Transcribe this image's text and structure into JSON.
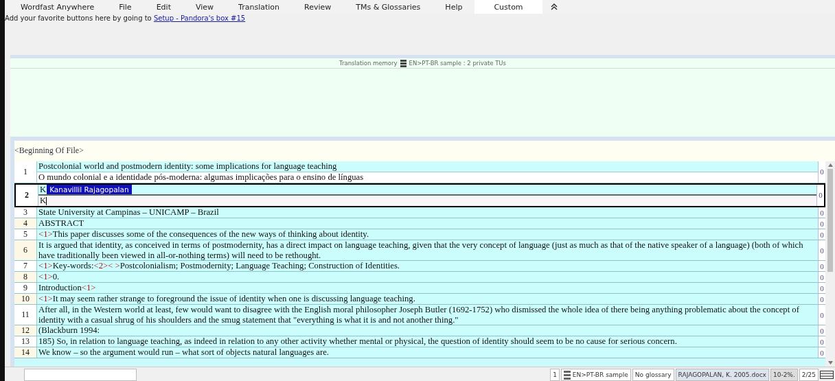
{
  "menu": [
    {
      "label": "Wordfast Anywhere",
      "selected": false
    },
    {
      "label": "File",
      "selected": false
    },
    {
      "label": "Edit",
      "selected": false
    },
    {
      "label": "View",
      "selected": false
    },
    {
      "label": "Translation",
      "selected": false
    },
    {
      "label": "Review",
      "selected": false
    },
    {
      "label": "TMs & Glossaries",
      "selected": false
    },
    {
      "label": "Help",
      "selected": false
    },
    {
      "label": "Custom",
      "selected": true
    }
  ],
  "hint": {
    "text": "Add your favorite buttons here by going to",
    "link": "Setup - Pandora's box #15"
  },
  "tm_panel": {
    "label": "Translation memory",
    "tm_name": "EN>PT-BR sample : 2 private TUs"
  },
  "editor": {
    "file_start": "<Beginning Of File>",
    "segments": [
      {
        "number": "1",
        "active": false,
        "count": "0",
        "source": [
          {
            "kind": "text",
            "text": "Postcolonial world and postmodern identity: some implications for language teaching"
          }
        ],
        "target": [
          {
            "kind": "text",
            "text": "O mundo colonial e a identidade pós-moderna: algumas implicações para o ensino de línguas"
          }
        ]
      },
      {
        "number": "2",
        "active": true,
        "count": "0",
        "source": [
          {
            "kind": "text",
            "text": "K"
          }
        ],
        "suggestion": "Kanavillil Rajagopalan",
        "target": [
          {
            "kind": "text",
            "text": "K"
          }
        ]
      },
      {
        "number": "3",
        "active": false,
        "count": "0",
        "source": [
          {
            "kind": "text",
            "text": "State University at Campinas – UNICAMP – Brazil"
          }
        ]
      },
      {
        "number": "4",
        "active": false,
        "count": "0",
        "source": [
          {
            "kind": "text",
            "text": "ABSTRACT"
          }
        ]
      },
      {
        "number": "5",
        "active": false,
        "count": "0",
        "source": [
          {
            "kind": "tag",
            "text": "<1>"
          },
          {
            "kind": "text",
            "text": "This paper discusses some of the consequences of the new ways of thinking about identity."
          }
        ]
      },
      {
        "number": "6",
        "active": false,
        "count": "0",
        "source": [
          {
            "kind": "text",
            "text": "It is argued that identity, as conceived in terms of postmodernity, has a direct impact on language teaching, given that the very concept of language (just as much as that of the native speaker of a language) (both of which have traditionally been viewed in all-or-nothing terms) will need to be rethought."
          }
        ]
      },
      {
        "number": "7",
        "active": false,
        "count": "0",
        "source": [
          {
            "kind": "tag",
            "text": "<1>"
          },
          {
            "kind": "text",
            "text": "Key-words:"
          },
          {
            "kind": "tag",
            "text": "<2>"
          },
          {
            "kind": "tag",
            "text": "< >"
          },
          {
            "kind": "text",
            "text": "Postcolonialism; Postmodernity; Language Teaching; Construction of Identities."
          }
        ]
      },
      {
        "number": "8",
        "active": false,
        "count": "0",
        "source": [
          {
            "kind": "tag",
            "text": "<1>"
          },
          {
            "kind": "text",
            "text": "0."
          }
        ]
      },
      {
        "number": "9",
        "active": false,
        "count": "0",
        "source": [
          {
            "kind": "text",
            "text": "Introduction"
          },
          {
            "kind": "tag",
            "text": "<1>"
          }
        ]
      },
      {
        "number": "10",
        "active": false,
        "count": "0",
        "source": [
          {
            "kind": "tag",
            "text": "<1>"
          },
          {
            "kind": "text",
            "text": "It may seem rather strange to foreground the issue of identity when one is discussing language teaching."
          }
        ]
      },
      {
        "number": "11",
        "active": false,
        "count": "0",
        "source": [
          {
            "kind": "text",
            "text": "After all, in the Western world at least, few would want to disagree with the English moral philosopher Joseph Butler (1692-1752) who dismissed the whole idea of there being anything problematic about the concept of identity with a casual shrug of his shoulders and the smug statement that \"everything is what it is and not another thing.\""
          }
        ]
      },
      {
        "number": "12",
        "active": false,
        "count": "0",
        "source": [
          {
            "kind": "text",
            "text": "(Blackburn 1994:"
          }
        ]
      },
      {
        "number": "13",
        "active": false,
        "count": "0",
        "source": [
          {
            "kind": "text",
            "text": "185) So, in relation to language teaching, as indeed in relation to any other activity whether mental or physical, the question of identity should seem to be no cause for serious concern."
          }
        ]
      },
      {
        "number": "14",
        "active": false,
        "count": "0",
        "source": [
          {
            "kind": "text",
            "text": "We know – so the argument would run – what sort of objects natural languages are."
          }
        ]
      }
    ]
  },
  "status_bar": {
    "segment": "1",
    "tm": "EN>PT-BR sample",
    "glossary": "No glossary",
    "file": "RAJAGOPALAN, K. 2005.docx",
    "progress": "10-2%.",
    "position": "2/25"
  }
}
